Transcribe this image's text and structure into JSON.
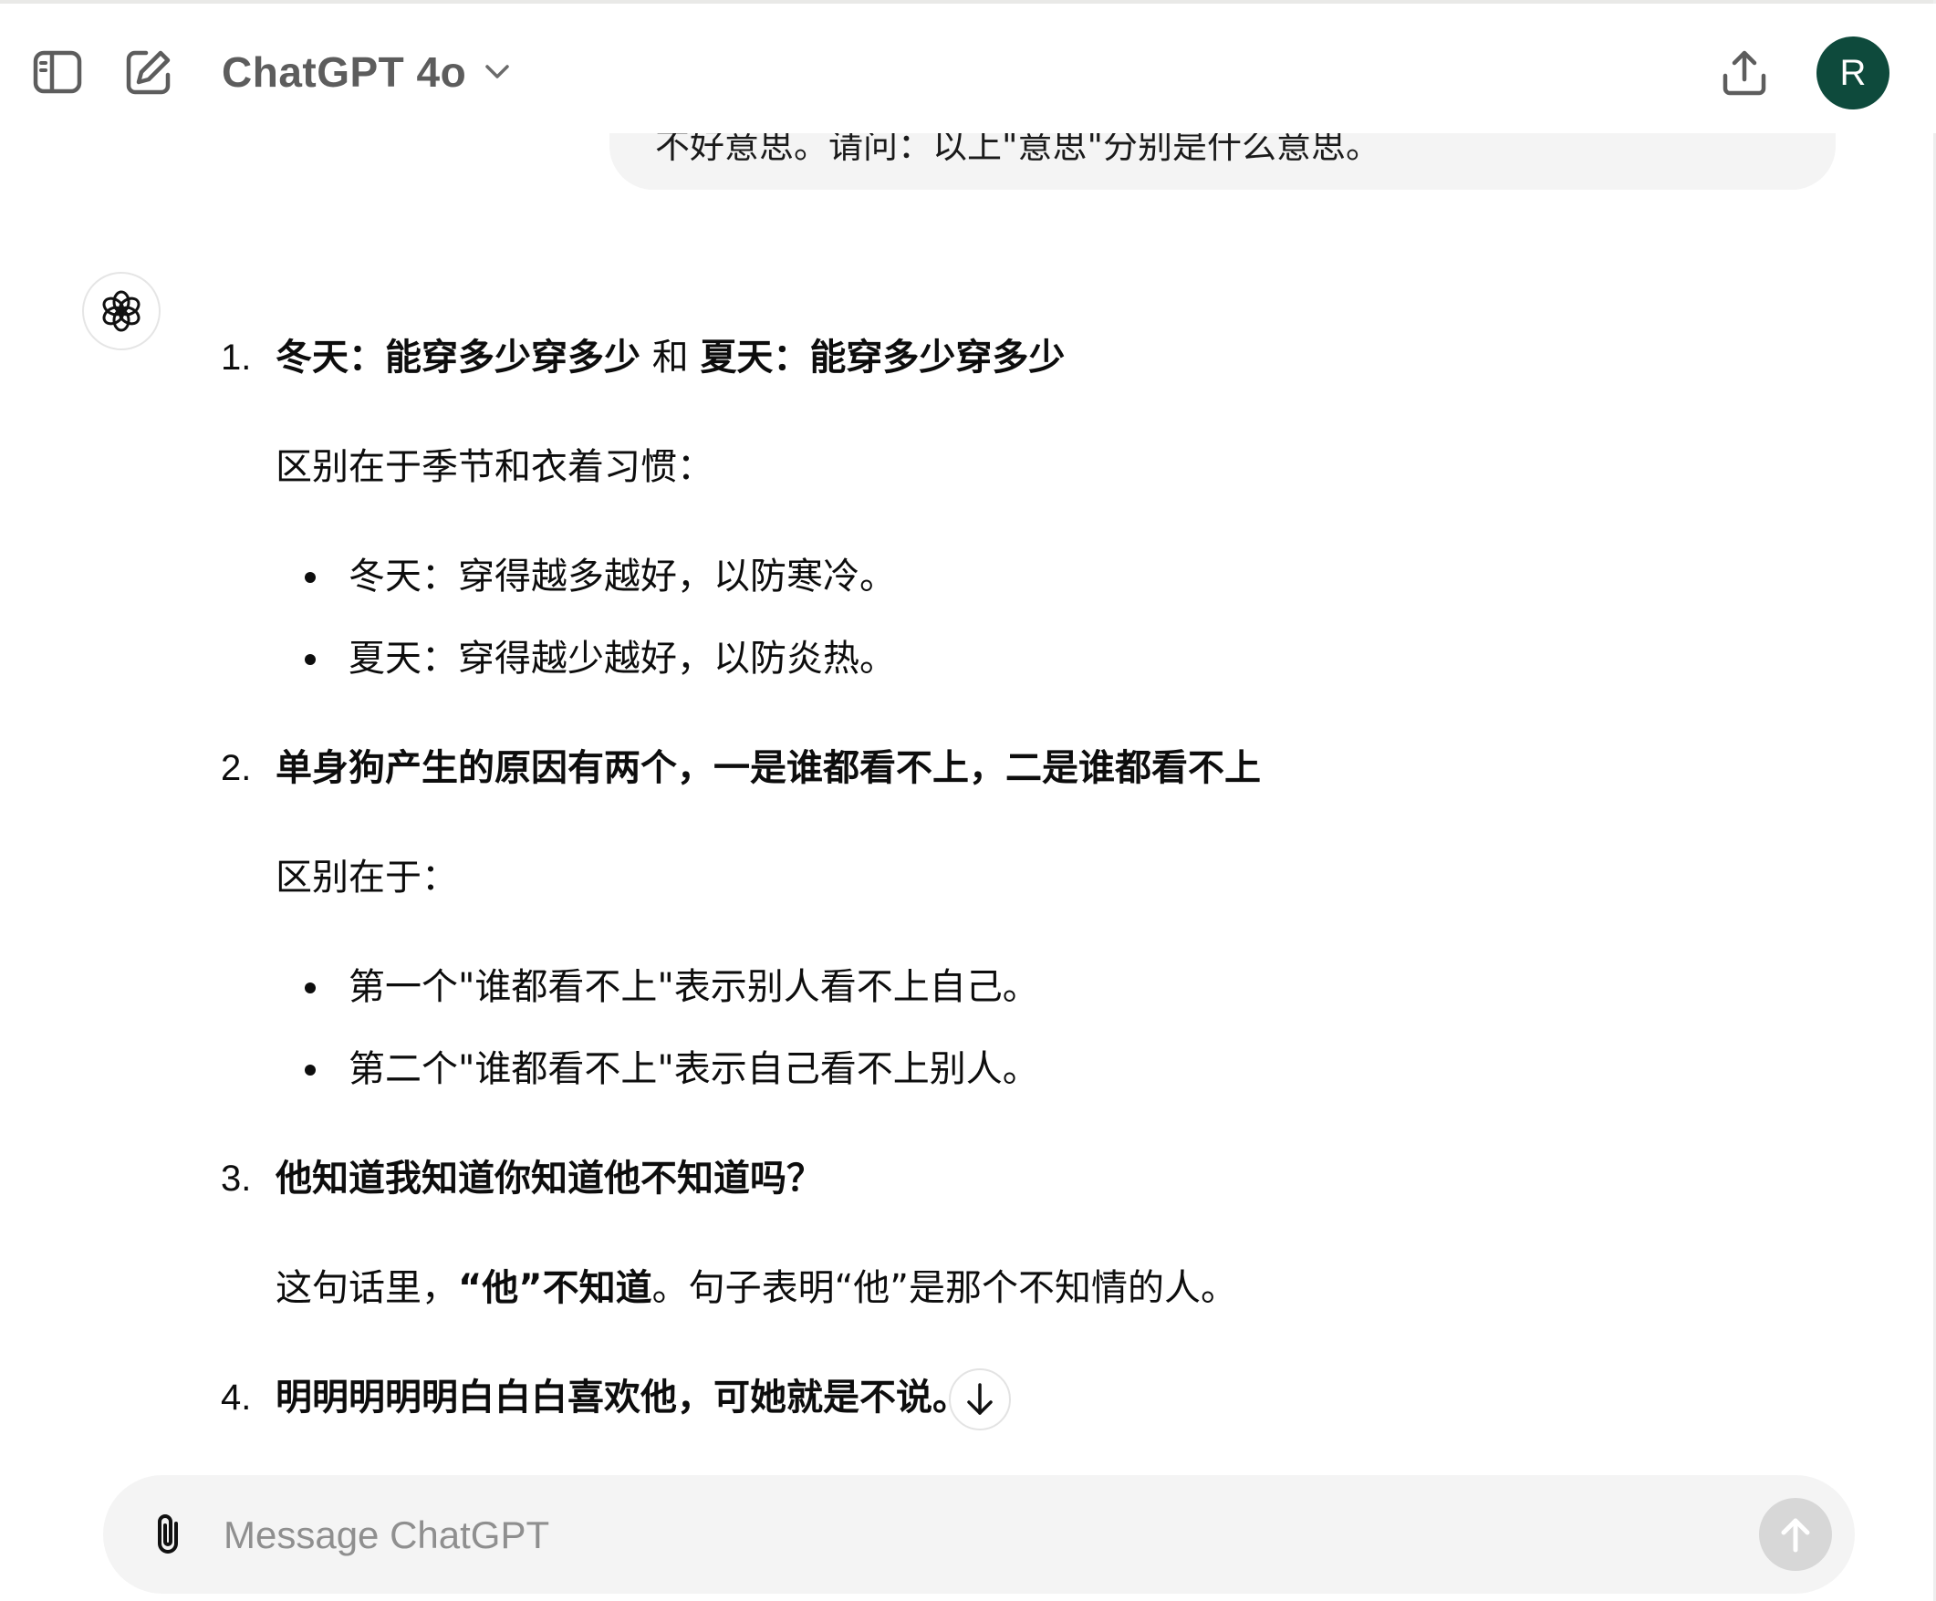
{
  "header": {
    "model_name": "ChatGPT 4o",
    "avatar_letter": "R",
    "sidebar_icon": "sidebar-toggle-icon",
    "new_chat_icon": "edit-icon",
    "share_icon": "share-upload-icon"
  },
  "user_message": {
    "visible_text": "不好意思。请问：以上\"意思\"分别是什么意思。"
  },
  "answer": {
    "items": [
      {
        "number": "1.",
        "title_parts": [
          "冬天：能穿多少穿多少",
          " 和 ",
          "夏天：能穿多少穿多少"
        ],
        "intro": "区别在于季节和衣着习惯：",
        "bullets": [
          "冬天：穿得越多越好，以防寒冷。",
          "夏天：穿得越少越好，以防炎热。"
        ]
      },
      {
        "number": "2.",
        "title": "单身狗产生的原因有两个，一是谁都看不上，二是谁都看不上",
        "intro": "区别在于：",
        "bullets": [
          "第一个\"谁都看不上\"表示别人看不上自己。",
          "第二个\"谁都看不上\"表示自己看不上别人。"
        ]
      },
      {
        "number": "3.",
        "title": "他知道我知道你知道他不知道吗？",
        "body_parts": [
          "这句话里，",
          "“他”不知道",
          "。句子表明“他”是那个不知情的人。"
        ]
      },
      {
        "number": "4.",
        "title": "明明明明明白白白喜欢他，可她就是不说。"
      }
    ]
  },
  "composer": {
    "placeholder": "Message ChatGPT",
    "value": ""
  },
  "colors": {
    "avatar_bg": "#0e4a3c",
    "bubble_bg": "#f4f4f4",
    "send_disabled": "#d7d7d7"
  }
}
